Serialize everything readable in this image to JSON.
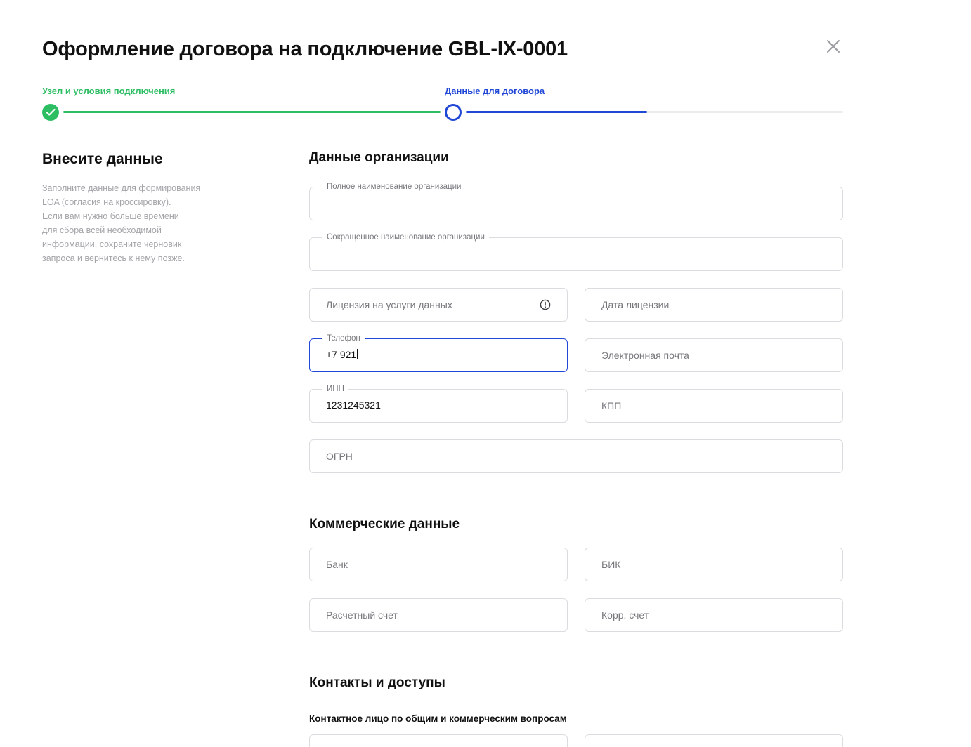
{
  "modal": {
    "title": "Оформление договора на подключение GBL-IX-0001",
    "close_icon": "close-icon"
  },
  "stepper": {
    "steps": [
      {
        "label": "Узел и условия подключения",
        "status": "completed"
      },
      {
        "label": "Данные для договора",
        "status": "active",
        "progress": 0.48
      }
    ],
    "colors": {
      "completed": "#2DBE64",
      "active": "#2147D6",
      "track": "#ECECEE"
    }
  },
  "side": {
    "title": "Внесите данные",
    "description_lines": [
      "Заполните данные для формирования",
      "LOA (согласия на кроссировку).",
      "Если вам нужно больше времени",
      "для сбора всей необходимой",
      "информации, сохраните черновик",
      "запроса и вернитесь к нему позже."
    ]
  },
  "organization": {
    "title": "Данные организации",
    "full_name": {
      "label": "Полное наименование организации",
      "value": ""
    },
    "short_name": {
      "label": "Сокращенное наименование организации",
      "value": ""
    },
    "license": {
      "placeholder": "Лицензия на услуги данных",
      "icon": "info-icon"
    },
    "license_date": {
      "placeholder": "Дата лицензии"
    },
    "phone": {
      "label": "Телефон",
      "value": "+7 921"
    },
    "email": {
      "placeholder": "Электронная почта"
    },
    "inn": {
      "label": "ИНН",
      "value": "1231245321"
    },
    "kpp": {
      "placeholder": "КПП"
    },
    "ogrn": {
      "placeholder": "ОГРН"
    }
  },
  "commercial": {
    "title": "Коммерческие данные",
    "bank": {
      "placeholder": "Банк"
    },
    "bik": {
      "placeholder": "БИК"
    },
    "account": {
      "placeholder": "Расчетный счет"
    },
    "corr_account": {
      "placeholder": "Корр. счет"
    }
  },
  "contacts": {
    "title": "Контакты и доступы",
    "subtitle": "Контактное лицо по общим и коммерческим вопросам"
  }
}
